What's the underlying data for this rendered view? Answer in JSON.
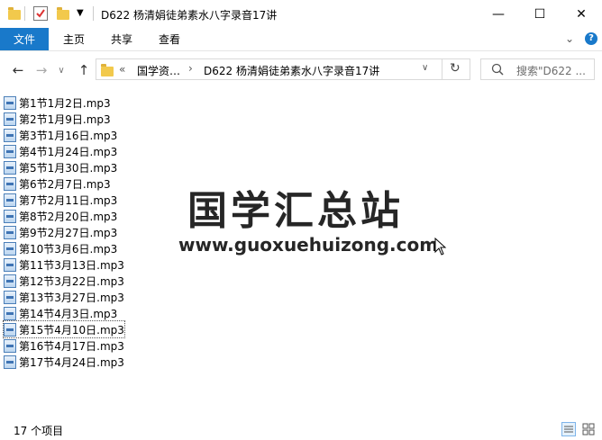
{
  "window": {
    "title": "D622 杨清娟徒弟素水八字录音17讲",
    "minimize": "—",
    "maximize": "☐",
    "close": "✕"
  },
  "ribbon": {
    "tabs": [
      "文件",
      "主页",
      "共享",
      "查看"
    ],
    "expand": "⌄",
    "help": "?"
  },
  "nav": {
    "back": "←",
    "forward": "→",
    "recent": "∨",
    "up": "↑",
    "breadcrumb": {
      "overflow": "«",
      "items": [
        "国学资…",
        "D622 杨清娟徒弟素水八字录音17讲"
      ],
      "sep": "›"
    },
    "dropdown": "∨",
    "refresh": "↻",
    "search_placeholder": "搜索\"D622 ..."
  },
  "files": [
    "第1节1月2日.mp3",
    "第2节1月9日.mp3",
    "第3节1月16日.mp3",
    "第4节1月24日.mp3",
    "第5节1月30日.mp3",
    "第6节2月7日.mp3",
    "第7节2月11日.mp3",
    "第8节2月20日.mp3",
    "第9节2月27日.mp3",
    "第10节3月6日.mp3",
    "第11节3月13日.mp3",
    "第12节3月22日.mp3",
    "第13节3月27日.mp3",
    "第14节4月3日.mp3",
    "第15节4月10日.mp3",
    "第16节4月17日.mp3",
    "第17节4月24日.mp3"
  ],
  "selected_index": 14,
  "watermark": {
    "title": "国学汇总站",
    "url": "www.guoxuehuizong.com"
  },
  "status": {
    "count": "17 个项目"
  },
  "colors": {
    "accent": "#1979ca",
    "folder": "#f2c94c"
  }
}
